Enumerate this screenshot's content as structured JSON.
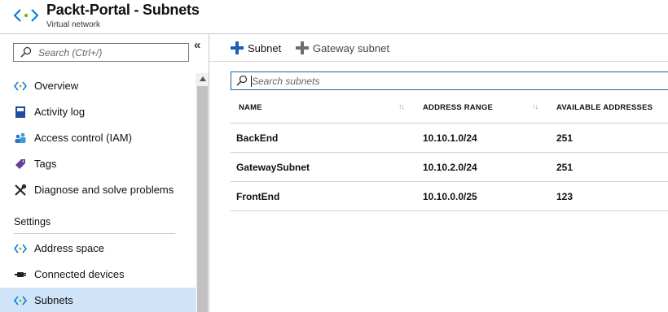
{
  "header": {
    "title": "Packt-Portal - Subnets",
    "subtitle": "Virtual network",
    "accent": "#0078d4"
  },
  "sidebar": {
    "search_placeholder": "Search (Ctrl+/)",
    "collapse_glyph": "«",
    "items": [
      {
        "label": "Overview",
        "icon": "vnet-icon"
      },
      {
        "label": "Activity log",
        "icon": "activity-log-icon"
      },
      {
        "label": "Access control (IAM)",
        "icon": "iam-icon"
      },
      {
        "label": "Tags",
        "icon": "tag-icon"
      },
      {
        "label": "Diagnose and solve problems",
        "icon": "wrench-icon"
      }
    ],
    "section_heading": "Settings",
    "settings_items": [
      {
        "label": "Address space",
        "icon": "vnet-icon"
      },
      {
        "label": "Connected devices",
        "icon": "plug-icon"
      },
      {
        "label": "Subnets",
        "icon": "vnet-icon",
        "active": true
      }
    ]
  },
  "toolbar": {
    "add_subnet_label": "Subnet",
    "add_gateway_subnet_label": "Gateway subnet"
  },
  "subnets_search": {
    "placeholder": "Search subnets"
  },
  "table": {
    "columns": [
      "NAME",
      "ADDRESS RANGE",
      "AVAILABLE ADDRESSES"
    ],
    "rows": [
      {
        "name": "BackEnd",
        "address_range": "10.10.1.0/24",
        "available": "251"
      },
      {
        "name": "GatewaySubnet",
        "address_range": "10.10.2.0/24",
        "available": "251"
      },
      {
        "name": "FrontEnd",
        "address_range": "10.10.0.0/25",
        "available": "123"
      }
    ]
  }
}
